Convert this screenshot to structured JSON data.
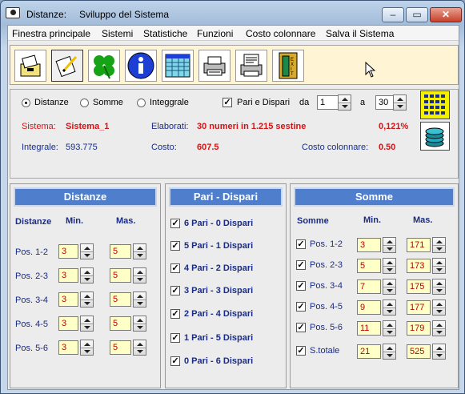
{
  "window": {
    "title_left": "Distanze:",
    "title_right": "Sviluppo del Sistema"
  },
  "menu": [
    "Finestra principale",
    "Sistemi",
    "Statistiche",
    "Funzioni",
    "Costo colonnare",
    "Salva il Sistema"
  ],
  "toolbar": {
    "buttons": [
      "open-icon",
      "edit-icon",
      "clover-icon",
      "info-icon",
      "table-icon",
      "printer-icon",
      "printer-text-icon",
      "exit-door-icon"
    ]
  },
  "options": {
    "radio_distanze": "Distanze",
    "radio_somme": "Somme",
    "radio_integrale": "Integgrale",
    "selected_radio": "distanze",
    "pari_dispari_label": "Pari e Dispari",
    "pari_dispari_checked": true,
    "da_label": "da",
    "da_value": "1",
    "a_label": "a",
    "a_value": "30"
  },
  "info": {
    "sistema_label": "Sistema:",
    "sistema_value": "Sistema_1",
    "elaborati_label": "Elaborati:",
    "elaborati_value": "30 numeri in  1.215  sestine",
    "percent_value": "0,121%",
    "integrale_label": "Integrale:",
    "integrale_value": "593.775",
    "costo_label": "Costo:",
    "costo_value": "607.5",
    "costo_col_label": "Costo colonnare:",
    "costo_col_value": "0.50"
  },
  "distanze": {
    "title": "Distanze",
    "col_label": "Distanze",
    "col_min": "Min.",
    "col_max": "Mas.",
    "rows": [
      {
        "label": "Pos. 1-2",
        "min": "3",
        "max": "5"
      },
      {
        "label": "Pos. 2-3",
        "min": "3",
        "max": "5"
      },
      {
        "label": "Pos. 3-4",
        "min": "3",
        "max": "5"
      },
      {
        "label": "Pos. 4-5",
        "min": "3",
        "max": "5"
      },
      {
        "label": "Pos. 5-6",
        "min": "3",
        "max": "5"
      }
    ]
  },
  "pari_dispari": {
    "title": "Pari - Dispari",
    "items": [
      {
        "label": "6 Pari - 0 Dispari",
        "checked": true
      },
      {
        "label": "5 Pari - 1 Dispari",
        "checked": true
      },
      {
        "label": "4 Pari - 2 Dispari",
        "checked": true
      },
      {
        "label": "3 Pari - 3 Dispari",
        "checked": true
      },
      {
        "label": "2 Pari - 4 Dispari",
        "checked": true
      },
      {
        "label": "1 Pari - 5 Dispari",
        "checked": true
      },
      {
        "label": "0 Pari - 6 Dispari",
        "checked": true
      }
    ]
  },
  "somme": {
    "title": "Somme",
    "col_label": "Somme",
    "col_min": "Min.",
    "col_max": "Mas.",
    "rows": [
      {
        "label": "Pos. 1-2",
        "min": "3",
        "max": "171",
        "checked": true
      },
      {
        "label": "Pos. 2-3",
        "min": "5",
        "max": "173",
        "checked": true
      },
      {
        "label": "Pos. 3-4",
        "min": "7",
        "max": "175",
        "checked": true
      },
      {
        "label": "Pos. 4-5",
        "min": "9",
        "max": "177",
        "checked": true
      },
      {
        "label": "Pos. 5-6",
        "min": "11",
        "max": "179",
        "checked": true
      },
      {
        "label": "S.totale",
        "min": "21",
        "max": "525",
        "checked": true
      }
    ]
  },
  "colors": {
    "accent_blue": "#4f7fcc",
    "value_red": "#d41414",
    "label_navy": "#1a2c86",
    "toolbar_bg": "#fff4d4"
  }
}
